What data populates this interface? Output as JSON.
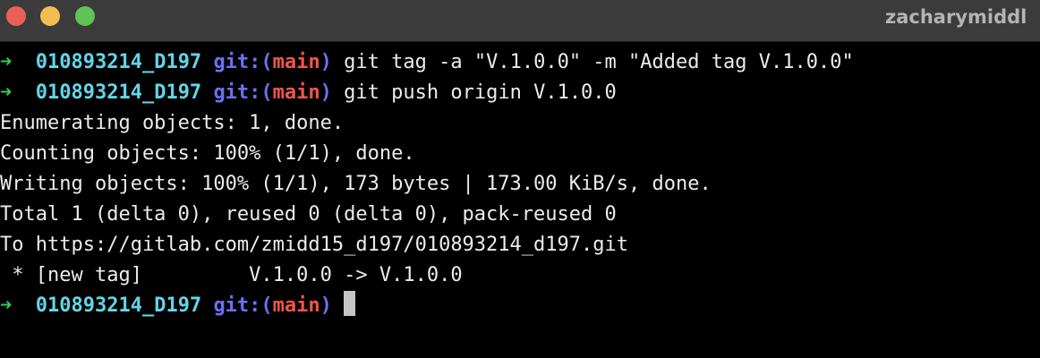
{
  "window": {
    "title": "zacharymiddl"
  },
  "prompt": {
    "arrow": "➜",
    "directory": "010893214_D197",
    "git_prefix": "git:(",
    "branch": "main",
    "git_suffix": ")"
  },
  "commands": [
    "git tag -a \"V.1.0.0\" -m \"Added tag V.1.0.0\"",
    "git push origin V.1.0.0"
  ],
  "output": [
    "Enumerating objects: 1, done.",
    "Counting objects: 100% (1/1), done.",
    "Writing objects: 100% (1/1), 173 bytes | 173.00 KiB/s, done.",
    "Total 1 (delta 0), reused 0 (delta 0), pack-reused 0",
    "To https://gitlab.com/zmidd15_d197/010893214_d197.git",
    " * [new tag]         V.1.0.0 -> V.1.0.0"
  ],
  "colors": {
    "arrow": "#35c85a",
    "directory": "#62d6e8",
    "git": "#6c71f0",
    "branch": "#f2554a",
    "text": "#ececec",
    "background": "#000000"
  }
}
